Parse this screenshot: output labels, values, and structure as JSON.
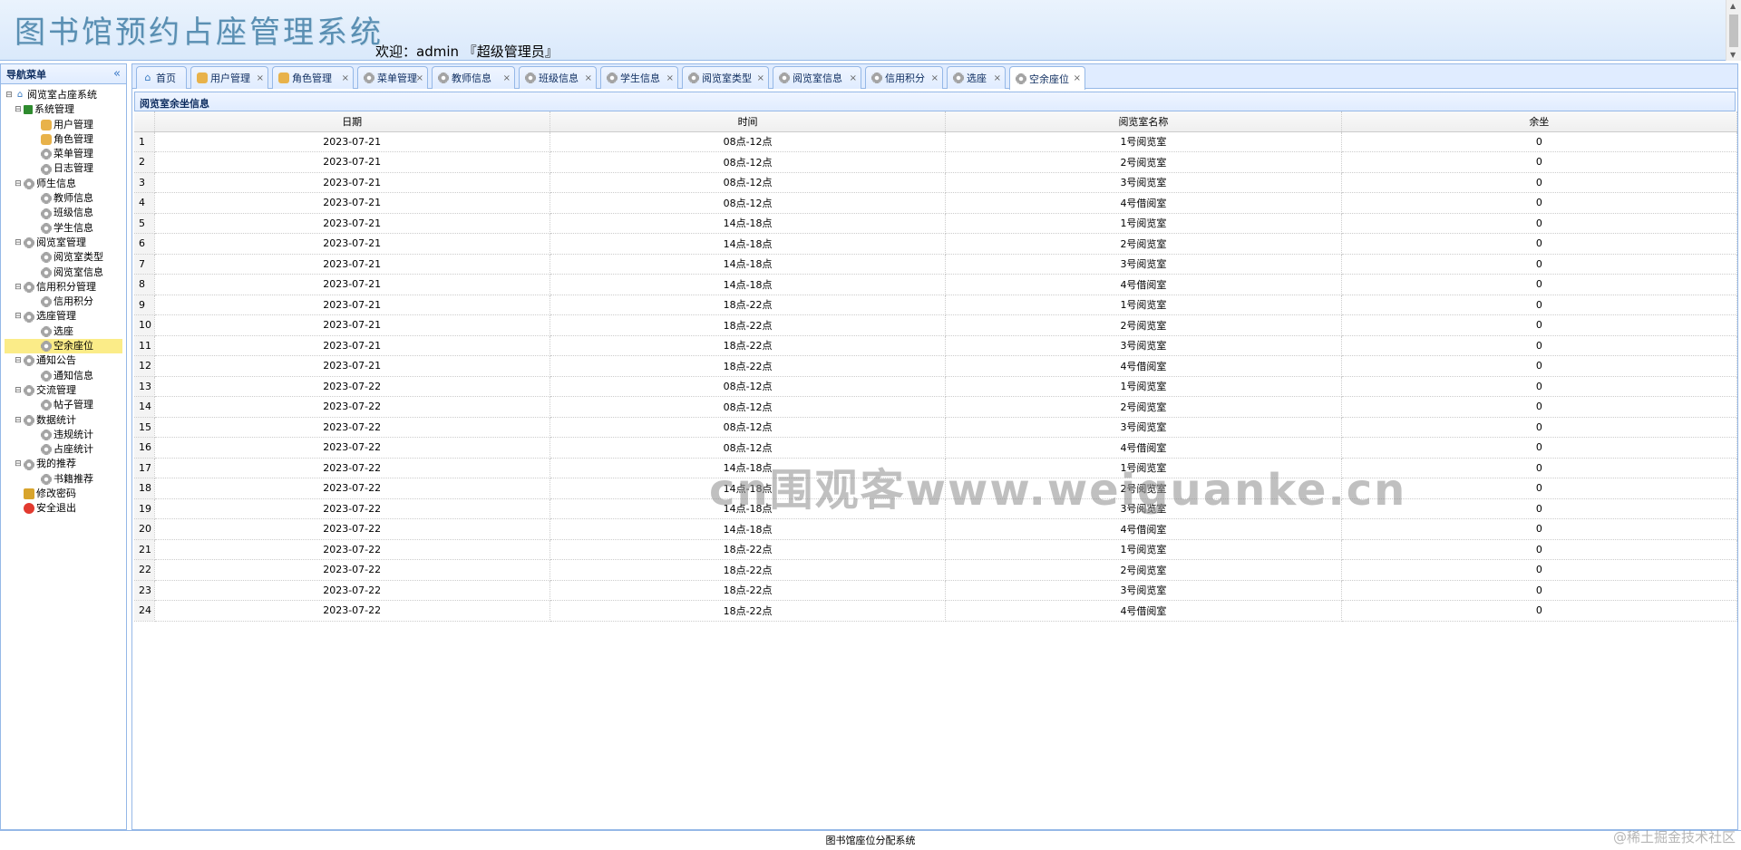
{
  "header": {
    "app_title": "图书馆预约占座管理系统",
    "welcome": "欢迎：admin 『超级管理员』"
  },
  "sidebar": {
    "title": "导航菜单",
    "tree": [
      {
        "label": "阅览室占座系统",
        "level": 0,
        "icon": "home-icon"
      },
      {
        "label": "系统管理",
        "level": 1,
        "icon": "system-icon"
      },
      {
        "label": "用户管理",
        "level": 2,
        "icon": "user-icon"
      },
      {
        "label": "角色管理",
        "level": 2,
        "icon": "role-icon"
      },
      {
        "label": "菜单管理",
        "level": 2,
        "icon": "menu-icon"
      },
      {
        "label": "日志管理",
        "level": 2,
        "icon": "log-icon"
      },
      {
        "label": "师生信息",
        "level": 1,
        "icon": "gear-icon"
      },
      {
        "label": "教师信息",
        "level": 2,
        "icon": "gear-icon"
      },
      {
        "label": "班级信息",
        "level": 2,
        "icon": "gear-icon"
      },
      {
        "label": "学生信息",
        "level": 2,
        "icon": "gear-icon"
      },
      {
        "label": "阅览室管理",
        "level": 1,
        "icon": "gear-icon"
      },
      {
        "label": "阅览室类型",
        "level": 2,
        "icon": "gear-icon"
      },
      {
        "label": "阅览室信息",
        "level": 2,
        "icon": "gear-icon"
      },
      {
        "label": "信用积分管理",
        "level": 1,
        "icon": "gear-icon"
      },
      {
        "label": "信用积分",
        "level": 2,
        "icon": "gear-icon"
      },
      {
        "label": "选座管理",
        "level": 1,
        "icon": "gear-icon"
      },
      {
        "label": "选座",
        "level": 2,
        "icon": "gear-icon"
      },
      {
        "label": "空余座位",
        "level": 2,
        "icon": "gear-icon",
        "selected": true
      },
      {
        "label": "通知公告",
        "level": 1,
        "icon": "gear-icon"
      },
      {
        "label": "通知信息",
        "level": 2,
        "icon": "gear-icon"
      },
      {
        "label": "交流管理",
        "level": 1,
        "icon": "gear-icon"
      },
      {
        "label": "帖子管理",
        "level": 2,
        "icon": "gear-icon"
      },
      {
        "label": "数据统计",
        "level": 1,
        "icon": "gear-icon"
      },
      {
        "label": "违规统计",
        "level": 2,
        "icon": "gear-icon"
      },
      {
        "label": "占座统计",
        "level": 2,
        "icon": "gear-icon"
      },
      {
        "label": "我的推荐",
        "level": 1,
        "icon": "gear-icon"
      },
      {
        "label": "书籍推荐",
        "level": 2,
        "icon": "gear-icon"
      },
      {
        "label": "修改密码",
        "level": 1,
        "icon": "lock-icon"
      },
      {
        "label": "安全退出",
        "level": 1,
        "icon": "exit-icon"
      }
    ]
  },
  "tabs": [
    {
      "label": "首页",
      "icon": "home-icon",
      "closable": false
    },
    {
      "label": "用户管理",
      "icon": "user-icon",
      "closable": true
    },
    {
      "label": "角色管理",
      "icon": "role-icon",
      "closable": true
    },
    {
      "label": "菜单管理",
      "icon": "menu-icon",
      "closable": true
    },
    {
      "label": "教师信息",
      "icon": "gear-icon",
      "closable": true
    },
    {
      "label": "班级信息",
      "icon": "gear-icon",
      "closable": true
    },
    {
      "label": "学生信息",
      "icon": "gear-icon",
      "closable": true
    },
    {
      "label": "阅览室类型",
      "icon": "gear-icon",
      "closable": true
    },
    {
      "label": "阅览室信息",
      "icon": "gear-icon",
      "closable": true
    },
    {
      "label": "信用积分",
      "icon": "gear-icon",
      "closable": true
    },
    {
      "label": "选座",
      "icon": "gear-icon",
      "closable": true
    },
    {
      "label": "空余座位",
      "icon": "gear-icon",
      "closable": true,
      "active": true
    }
  ],
  "panel": {
    "title": "阅览室余坐信息"
  },
  "grid": {
    "columns": [
      "日期",
      "时间",
      "阅览室名称",
      "余坐"
    ],
    "rows": [
      {
        "n": "1",
        "date": "2023-07-21",
        "time": "08点-12点",
        "room": "1号阅览室",
        "free": "0"
      },
      {
        "n": "2",
        "date": "2023-07-21",
        "time": "08点-12点",
        "room": "2号阅览室",
        "free": "0"
      },
      {
        "n": "3",
        "date": "2023-07-21",
        "time": "08点-12点",
        "room": "3号阅览室",
        "free": "0"
      },
      {
        "n": "4",
        "date": "2023-07-21",
        "time": "08点-12点",
        "room": "4号借阅室",
        "free": "0"
      },
      {
        "n": "5",
        "date": "2023-07-21",
        "time": "14点-18点",
        "room": "1号阅览室",
        "free": "0"
      },
      {
        "n": "6",
        "date": "2023-07-21",
        "time": "14点-18点",
        "room": "2号阅览室",
        "free": "0"
      },
      {
        "n": "7",
        "date": "2023-07-21",
        "time": "14点-18点",
        "room": "3号阅览室",
        "free": "0"
      },
      {
        "n": "8",
        "date": "2023-07-21",
        "time": "14点-18点",
        "room": "4号借阅室",
        "free": "0"
      },
      {
        "n": "9",
        "date": "2023-07-21",
        "time": "18点-22点",
        "room": "1号阅览室",
        "free": "0"
      },
      {
        "n": "10",
        "date": "2023-07-21",
        "time": "18点-22点",
        "room": "2号阅览室",
        "free": "0"
      },
      {
        "n": "11",
        "date": "2023-07-21",
        "time": "18点-22点",
        "room": "3号阅览室",
        "free": "0"
      },
      {
        "n": "12",
        "date": "2023-07-21",
        "time": "18点-22点",
        "room": "4号借阅室",
        "free": "0"
      },
      {
        "n": "13",
        "date": "2023-07-22",
        "time": "08点-12点",
        "room": "1号阅览室",
        "free": "0"
      },
      {
        "n": "14",
        "date": "2023-07-22",
        "time": "08点-12点",
        "room": "2号阅览室",
        "free": "0"
      },
      {
        "n": "15",
        "date": "2023-07-22",
        "time": "08点-12点",
        "room": "3号阅览室",
        "free": "0"
      },
      {
        "n": "16",
        "date": "2023-07-22",
        "time": "08点-12点",
        "room": "4号借阅室",
        "free": "0"
      },
      {
        "n": "17",
        "date": "2023-07-22",
        "time": "14点-18点",
        "room": "1号阅览室",
        "free": "0"
      },
      {
        "n": "18",
        "date": "2023-07-22",
        "time": "14点-18点",
        "room": "2号阅览室",
        "free": "0"
      },
      {
        "n": "19",
        "date": "2023-07-22",
        "time": "14点-18点",
        "room": "3号阅览室",
        "free": "0"
      },
      {
        "n": "20",
        "date": "2023-07-22",
        "time": "14点-18点",
        "room": "4号借阅室",
        "free": "0"
      },
      {
        "n": "21",
        "date": "2023-07-22",
        "time": "18点-22点",
        "room": "1号阅览室",
        "free": "0"
      },
      {
        "n": "22",
        "date": "2023-07-22",
        "time": "18点-22点",
        "room": "2号阅览室",
        "free": "0"
      },
      {
        "n": "23",
        "date": "2023-07-22",
        "time": "18点-22点",
        "room": "3号阅览室",
        "free": "0"
      },
      {
        "n": "24",
        "date": "2023-07-22",
        "time": "18点-22点",
        "room": "4号借阅室",
        "free": "0"
      }
    ]
  },
  "footer": {
    "text": "图书馆座位分配系统"
  },
  "watermarks": {
    "center": "cn围观客www.weiguanke.cn",
    "corner": "@稀土掘金技术社区"
  },
  "colors": {
    "border": "#95b8e7",
    "header_bg": "#dae9fb",
    "selected_bg": "#fbec88",
    "title_text": "#5a8fb3"
  }
}
